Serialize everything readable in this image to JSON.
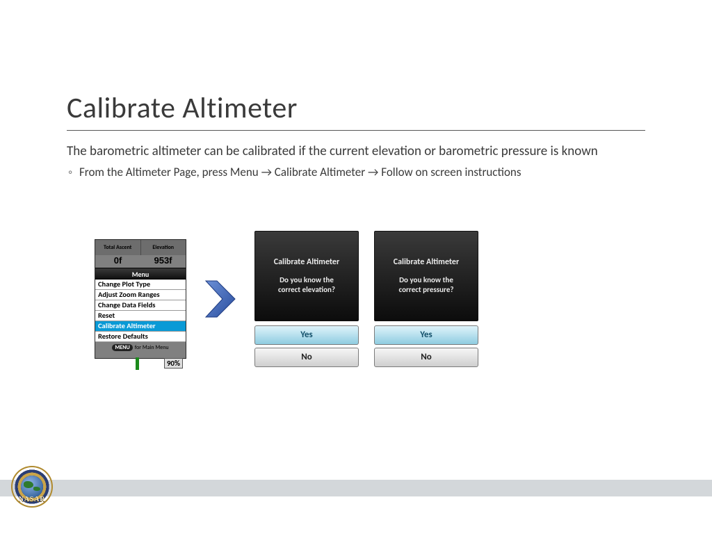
{
  "title": "Calibrate Altimeter",
  "lead": "The barometric altimeter can be calibrated if the current elevation or barometric pressure is known",
  "sub": "From the Altimeter Page, press Menu → Calibrate Altimeter → Follow on screen instructions",
  "device_menu": {
    "hdr_left": "Total Ascent",
    "hdr_right": "Elevation",
    "val_left": "0f",
    "val_right": "953f",
    "menu_label": "Menu",
    "items": [
      "Change Plot Type",
      "Adjust Zoom Ranges",
      "Change Data Fields",
      "Reset",
      "Calibrate Altimeter",
      "Restore Defaults"
    ],
    "selected_index": 4,
    "footer_pill": "MENU",
    "footer_text": "for Main Menu",
    "battery": "90%"
  },
  "dialog_a": {
    "title": "Calibrate Altimeter",
    "prompt": "Do you know the\ncorrect elevation?",
    "yes": "Yes",
    "no": "No"
  },
  "dialog_b": {
    "title": "Calibrate Altimeter",
    "prompt": "Do you know the\ncorrect pressure?",
    "yes": "Yes",
    "no": "No"
  },
  "logo_text": "NASAR"
}
